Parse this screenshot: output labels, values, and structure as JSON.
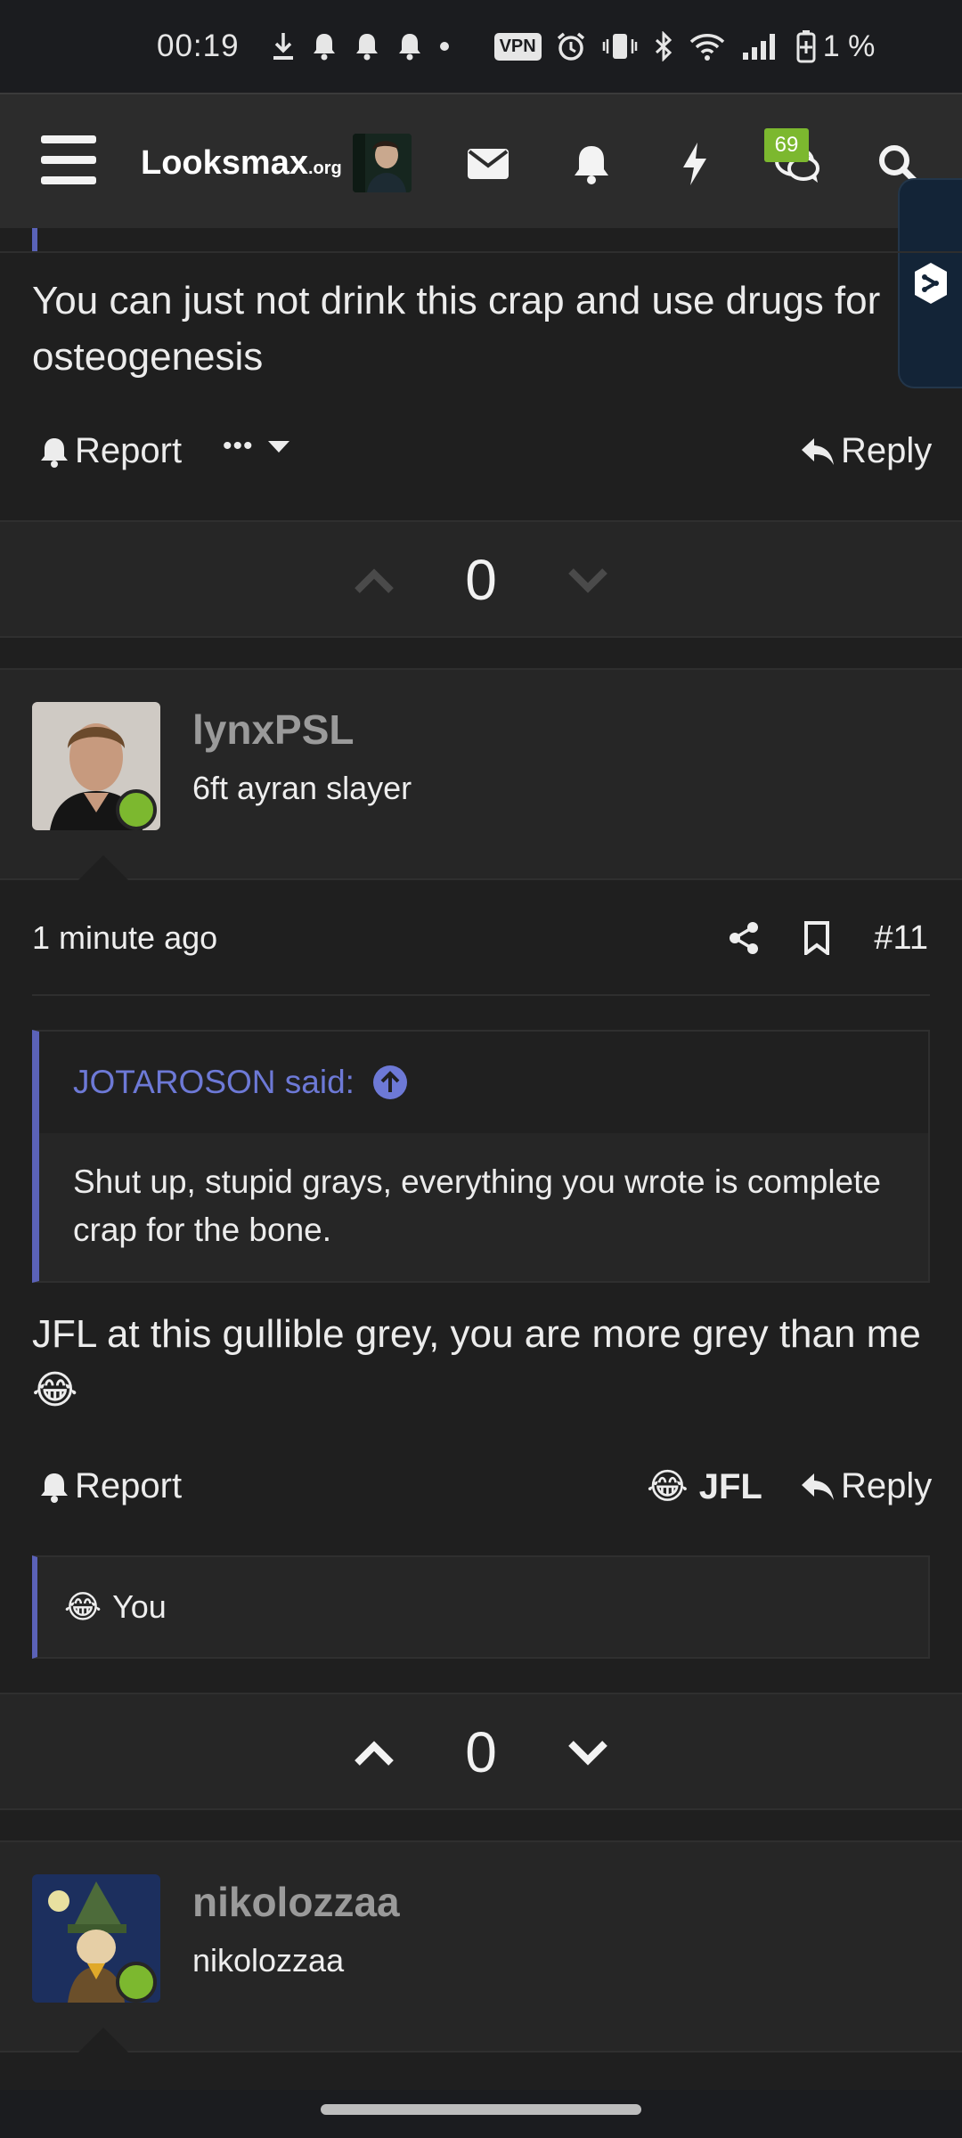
{
  "status_bar": {
    "time": "00:19",
    "vpn_label": "VPN",
    "battery_percent": "1 %",
    "icons": [
      "download-icon",
      "bell-icon",
      "bell-icon",
      "bell-icon",
      "dot-icon",
      "vpn-icon",
      "alarm-icon",
      "vibrate-icon",
      "bluetooth-icon",
      "wifi-icon",
      "signal-icon",
      "battery-icon"
    ]
  },
  "header": {
    "logo_main": "Looksmax",
    "logo_suffix": ".org",
    "notification_badge": "69",
    "icons": [
      "menu-icon",
      "avatar",
      "envelope-icon",
      "bell-icon",
      "bolt-icon",
      "chat-icon",
      "search-icon"
    ]
  },
  "posts": [
    {
      "body": "You can just not drink this crap and use drugs for osteogenesis",
      "actions": {
        "report": "Report",
        "more": "•••",
        "reply": "Reply"
      },
      "vote_count": "0"
    },
    {
      "user": {
        "name": "lynxPSL",
        "title": "6ft ayran slayer"
      },
      "time": "1 minute ago",
      "post_number": "#11",
      "quote": {
        "author_line": "JOTAROSON said:",
        "text": "Shut up, stupid grays, everything you wrote is complete crap for the bone."
      },
      "body": "JFL at this gullible grey, you are more grey than me",
      "body_emoji": "😂",
      "actions": {
        "report": "Report",
        "reaction_emoji": "😂",
        "reaction": "JFL",
        "reply": "Reply"
      },
      "reaction_summary": {
        "emoji": "😂",
        "text": "You"
      },
      "vote_count": "0"
    },
    {
      "user": {
        "name": "nikolozzaa",
        "title": "nikolozzaa"
      }
    }
  ],
  "colors": {
    "background": "#1f1f1f",
    "header": "#2c2c2c",
    "accent_quote": "#5b62b8",
    "quote_author": "#6d79d6",
    "online": "#7cb82f"
  }
}
